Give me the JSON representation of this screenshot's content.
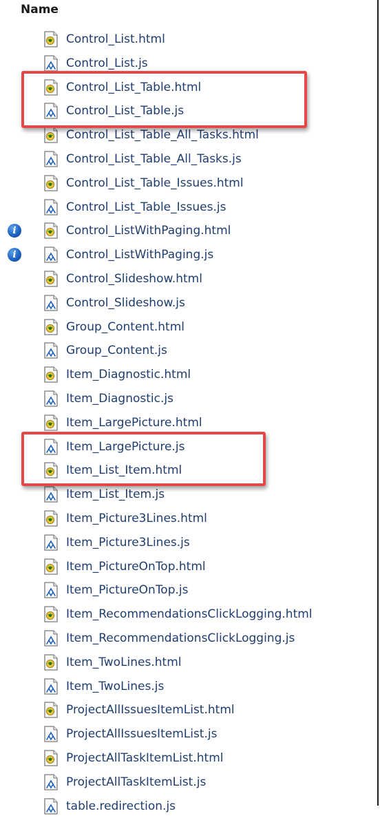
{
  "header": {
    "column_label": "Name"
  },
  "files": [
    {
      "name": "Control_List.html",
      "type": "html",
      "info": false
    },
    {
      "name": "Control_List.js",
      "type": "js",
      "info": false
    },
    {
      "name": "Control_List_Table.html",
      "type": "html",
      "info": false
    },
    {
      "name": "Control_List_Table.js",
      "type": "js",
      "info": false
    },
    {
      "name": "Control_List_Table_All_Tasks.html",
      "type": "html",
      "info": false
    },
    {
      "name": "Control_List_Table_All_Tasks.js",
      "type": "js",
      "info": false
    },
    {
      "name": "Control_List_Table_Issues.html",
      "type": "html",
      "info": false
    },
    {
      "name": "Control_List_Table_Issues.js",
      "type": "js",
      "info": false
    },
    {
      "name": "Control_ListWithPaging.html",
      "type": "html",
      "info": true
    },
    {
      "name": "Control_ListWithPaging.js",
      "type": "js",
      "info": true
    },
    {
      "name": "Control_Slideshow.html",
      "type": "html",
      "info": false
    },
    {
      "name": "Control_Slideshow.js",
      "type": "js",
      "info": false
    },
    {
      "name": "Group_Content.html",
      "type": "html",
      "info": false
    },
    {
      "name": "Group_Content.js",
      "type": "js",
      "info": false
    },
    {
      "name": "Item_Diagnostic.html",
      "type": "html",
      "info": false
    },
    {
      "name": "Item_Diagnostic.js",
      "type": "js",
      "info": false
    },
    {
      "name": "Item_LargePicture.html",
      "type": "html",
      "info": false
    },
    {
      "name": "Item_LargePicture.js",
      "type": "js",
      "info": false
    },
    {
      "name": "Item_List_Item.html",
      "type": "html",
      "info": false
    },
    {
      "name": "Item_List_Item.js",
      "type": "js",
      "info": false
    },
    {
      "name": "Item_Picture3Lines.html",
      "type": "html",
      "info": false
    },
    {
      "name": "Item_Picture3Lines.js",
      "type": "js",
      "info": false
    },
    {
      "name": "Item_PictureOnTop.html",
      "type": "html",
      "info": false
    },
    {
      "name": "Item_PictureOnTop.js",
      "type": "js",
      "info": false
    },
    {
      "name": "Item_RecommendationsClickLogging.html",
      "type": "html",
      "info": false
    },
    {
      "name": "Item_RecommendationsClickLogging.js",
      "type": "js",
      "info": false
    },
    {
      "name": "Item_TwoLines.html",
      "type": "html",
      "info": false
    },
    {
      "name": "Item_TwoLines.js",
      "type": "js",
      "info": false
    },
    {
      "name": "ProjectAllIssuesItemList.html",
      "type": "html",
      "info": false
    },
    {
      "name": "ProjectAllIssuesItemList.js",
      "type": "js",
      "info": false
    },
    {
      "name": "ProjectAllTaskItemList.html",
      "type": "html",
      "info": false
    },
    {
      "name": "ProjectAllTaskItemList.js",
      "type": "js",
      "info": false
    },
    {
      "name": "table.redirection.js",
      "type": "js",
      "info": false
    }
  ],
  "annotations": {
    "highlight_color": "#e8474a"
  },
  "icons": {
    "html": "html-file-icon",
    "js": "js-file-icon",
    "info": "info-icon"
  },
  "colors": {
    "file_name_text": "#1f3d6e",
    "header_text": "#1a1a1a",
    "info_badge": "#1f64c4"
  }
}
